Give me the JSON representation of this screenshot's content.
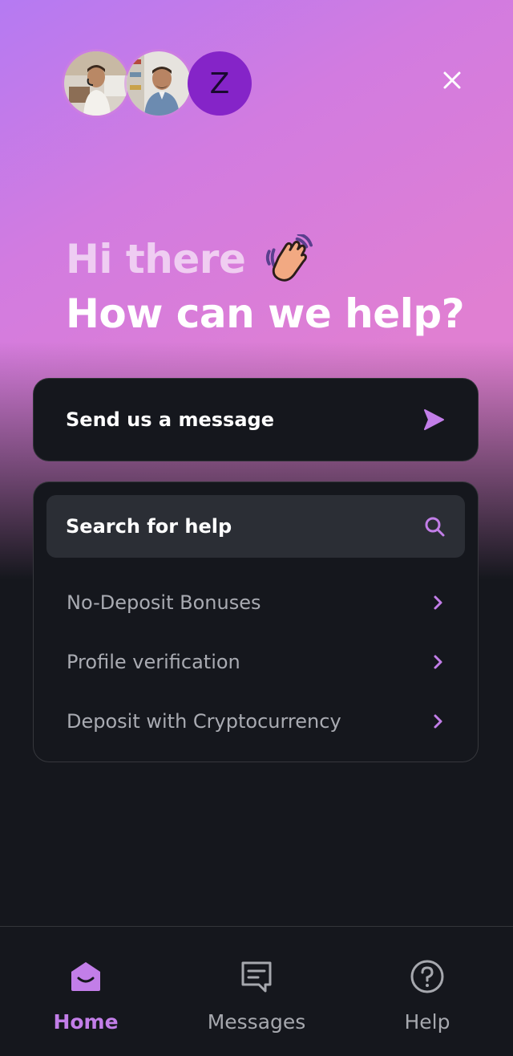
{
  "header": {
    "avatars": [
      {
        "type": "photo",
        "icon": "agent-photo-headset"
      },
      {
        "type": "photo",
        "icon": "agent-photo-smiling"
      },
      {
        "type": "initial",
        "initial": "Z",
        "color": "#8524c8"
      }
    ],
    "close_icon": "close-icon"
  },
  "greeting": {
    "line1": "Hi there",
    "emoji": "waving-hand-emoji",
    "line2": "How can we help?"
  },
  "send_card": {
    "label": "Send us a message",
    "icon": "send-arrow-icon"
  },
  "help_card": {
    "search_label": "Search for help",
    "search_icon": "search-icon",
    "items": [
      {
        "label": "No-Deposit Bonuses"
      },
      {
        "label": "Profile verification"
      },
      {
        "label": "Deposit with Cryptocurrency"
      }
    ]
  },
  "bottom_nav": {
    "items": [
      {
        "label": "Home",
        "icon": "home-icon",
        "active": true
      },
      {
        "label": "Messages",
        "icon": "messages-icon",
        "active": false
      },
      {
        "label": "Help",
        "icon": "help-icon",
        "active": false
      }
    ]
  },
  "colors": {
    "accent": "#c27ee8",
    "background": "#15171d",
    "card_border": "#2a2c32",
    "search_bg": "#2b2e35",
    "gradient_start": "#b57af2",
    "gradient_end": "#df80ce"
  }
}
